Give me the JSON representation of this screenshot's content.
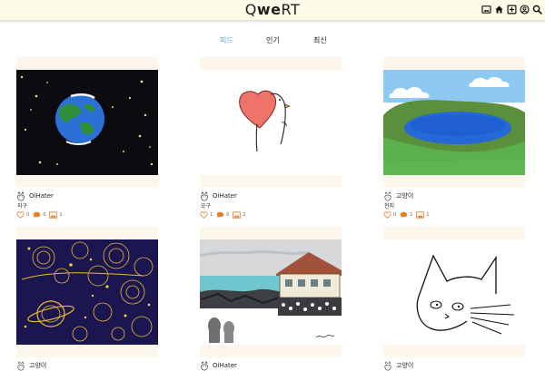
{
  "header": {
    "logo_part1": "Q",
    "logo_part2": "we",
    "logo_part3": "RT",
    "icons": [
      "gallery-icon",
      "home-icon",
      "add-icon",
      "profile-icon",
      "search-icon"
    ]
  },
  "tabs": [
    {
      "label": "피드",
      "active": true
    },
    {
      "label": "인기",
      "active": false
    },
    {
      "label": "최신",
      "active": false
    }
  ],
  "colors": {
    "accent": "#58a6d8",
    "header_bg": "#fffbe9",
    "card_bg": "#fdf6ea",
    "like": "#e0913c",
    "comment": "#e67e22"
  },
  "posts": [
    {
      "author": "OiHater",
      "title": "지구",
      "likes": "0",
      "comments": "0",
      "collections": "1",
      "art": "earth"
    },
    {
      "author": "OiHater",
      "title": "오구",
      "likes": "1",
      "comments": "0",
      "collections": "2",
      "art": "heart-duck"
    },
    {
      "author": "고양이",
      "title": "천지",
      "likes": "0",
      "comments": "1",
      "collections": "1",
      "art": "lake"
    },
    {
      "author": "고양이",
      "title": "",
      "likes": "",
      "comments": "",
      "collections": "",
      "art": "galaxy"
    },
    {
      "author": "OiHater",
      "title": "",
      "likes": "",
      "comments": "",
      "collections": "",
      "art": "seaside-house"
    },
    {
      "author": "고양이",
      "title": "",
      "likes": "",
      "comments": "",
      "collections": "",
      "art": "cat-sketch"
    }
  ]
}
